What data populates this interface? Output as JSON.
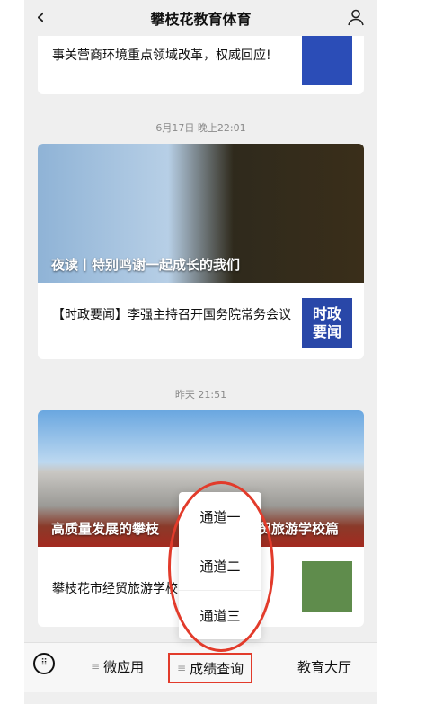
{
  "header": {
    "title": "攀枝花教育体育"
  },
  "cards": [
    {
      "text": "事关营商环境重点领域改革，权威回应!"
    },
    {
      "hero_caption": "夜读丨特别鸣谢一起成长的我们",
      "text": "【时政要闻】李强主持召开国务院常务会议",
      "thumb_text": [
        "时政",
        "要闻"
      ]
    },
    {
      "hero_caption": "高质量发展的攀枝",
      "hero_caption_tail": "贸旅游学校篇",
      "text": "攀枝花市经贸旅游学校"
    }
  ],
  "timestamps": [
    "6月17日 晚上22:01",
    "昨天 21:51"
  ],
  "popup": {
    "items": [
      "通道一",
      "通道二",
      "通道三"
    ]
  },
  "bottom_nav": {
    "tabs": [
      "微应用",
      "成绩查询",
      "教育大厅"
    ]
  },
  "icons": {
    "back": "chevron-left-icon",
    "user": "user-icon",
    "keyboard": "keyboard-icon",
    "menu": "menu-icon"
  },
  "colors": {
    "highlight": "#e23b2b",
    "thumb_blue": "#2947a8"
  }
}
